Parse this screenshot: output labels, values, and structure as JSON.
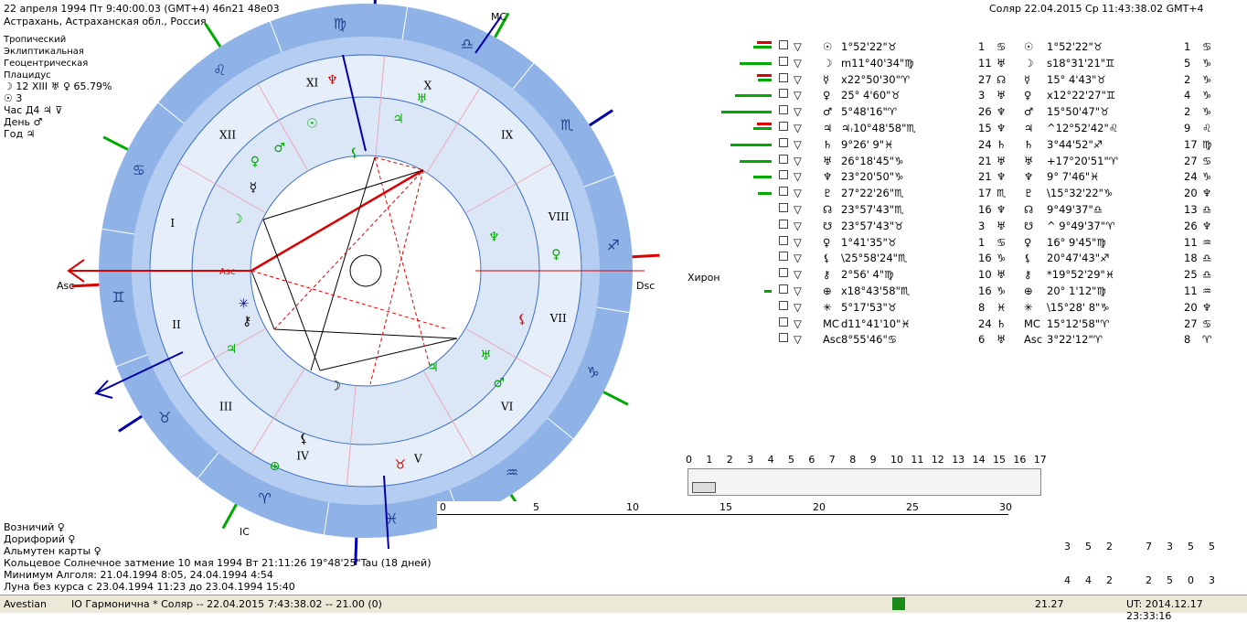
{
  "header": {
    "left_line1": "22 апреля 1994  Пт  9:40:00.03 (GMT+4) 46n21  48e03",
    "left_line2": "Астрахань, Астраханская обл., Россия",
    "right": "Соляр 22.04.2015  Ср 11:43:38.02 GMT+4"
  },
  "left_info": {
    "lines": [
      "Тропический",
      "Эклиптикальная",
      "Геоцентрическая",
      "Плацидус"
    ],
    "moon_line": "☽  12 XIII  ♅ ♀ 65.79%",
    "sun_line": "☉  3",
    "hour_line": "Час Д4 ♃ ⊽",
    "day_line": "День ♂",
    "year_line": "Год ♃"
  },
  "chart": {
    "houses_roman": [
      "I",
      "II",
      "III",
      "IV",
      "V",
      "VI",
      "VII",
      "VIII",
      "IX",
      "X",
      "XI",
      "XII"
    ],
    "signs": [
      "♈",
      "♉",
      "♊",
      "♋",
      "♌",
      "♍",
      "♎",
      "♏",
      "♐",
      "♑",
      "♒",
      "♓"
    ],
    "asc_label": "Asc",
    "dsc_label": "Dsc",
    "mc_label": "MC",
    "ic_label": "IC",
    "chiron_label": "Хирон"
  },
  "planet_table": {
    "rows": [
      {
        "g": "☉",
        "p1": "1°52'22\"♉",
        "n1": "1",
        "a1": "♋",
        "g2": "☉",
        "p2": "1°52'22\"♉",
        "n2": "1",
        "a2": "♋",
        "bar": 20,
        "red": true
      },
      {
        "g": "☽",
        "p1": "m11°40'34\"♍",
        "n1": "11",
        "a1": "♅",
        "g2": "☽",
        "p2": "s18°31'21\"♊",
        "n2": "5",
        "a2": "♑",
        "bar": 35,
        "red": false
      },
      {
        "g": "☿",
        "p1": "x22°50'30\"♈",
        "n1": "27",
        "a1": "☊",
        "g2": "☿",
        "p2": "15° 4'43\"♉",
        "n2": "2",
        "a2": "♑",
        "bar": 15,
        "red": true
      },
      {
        "g": "♀",
        "p1": "25° 4'60\"♉",
        "n1": "3",
        "a1": "♅",
        "g2": "♀",
        "p2": "x12°22'27\"♊",
        "n2": "4",
        "a2": "♑",
        "bar": 40,
        "red": false
      },
      {
        "g": "♂",
        "p1": "5°48'16\"♈",
        "n1": "26",
        "a1": "♆",
        "g2": "♂",
        "p2": "15°50'47\"♉",
        "n2": "2",
        "a2": "♑",
        "bar": 55,
        "red": false
      },
      {
        "g": "♃",
        "p1": "♃ᵣ10°48'58\"♏",
        "n1": "15",
        "a1": "♆",
        "g2": "♃",
        "p2": "^12°52'42\"♌",
        "n2": "9",
        "a2": "♌",
        "bar": 20,
        "red": true
      },
      {
        "g": "♄",
        "p1": "9°26' 9\"♓",
        "n1": "24",
        "a1": "♄",
        "g2": "♄",
        "p2": "3°44'52\"♐",
        "n2": "17",
        "a2": "♍",
        "bar": 45,
        "red": false
      },
      {
        "g": "♅",
        "p1": "26°18'45\"♑",
        "n1": "21",
        "a1": "♅",
        "g2": "♅",
        "p2": "+17°20'51\"♈",
        "n2": "27",
        "a2": "♋",
        "bar": 35,
        "red": false
      },
      {
        "g": "♆",
        "p1": "23°20'50\"♑",
        "n1": "21",
        "a1": "♆",
        "g2": "♆",
        "p2": "9° 7'46\"♓",
        "n2": "24",
        "a2": "♑",
        "bar": 20,
        "red": false
      },
      {
        "g": "♇",
        "p1": "27°22'26\"♏",
        "n1": "17",
        "a1": "♏",
        "g2": "♇",
        "p2": "\\15°32'22\"♑",
        "n2": "20",
        "a2": "♆",
        "bar": 15,
        "red": false
      },
      {
        "g": "☊",
        "p1": "23°57'43\"♏",
        "n1": "16",
        "a1": "♆",
        "g2": "☊",
        "p2": "9°49'37\"♎",
        "n2": "13",
        "a2": "♎",
        "bar": 0,
        "red": false
      },
      {
        "g": "☋",
        "p1": "23°57'43\"♉",
        "n1": "3",
        "a1": "♅",
        "g2": "☋",
        "p2": "^ 9°49'37\"♈",
        "n2": "26",
        "a2": "♆",
        "bar": 0,
        "red": false
      },
      {
        "g": "♀",
        "p1": "1°41'35\"♉",
        "n1": "1",
        "a1": "♋",
        "g2": "♀",
        "p2": "16° 9'45\"♍",
        "n2": "11",
        "a2": "♒",
        "bar": 0,
        "red": false
      },
      {
        "g": "⚸",
        "p1": "\\25°58'24\"♏",
        "n1": "16",
        "a1": "♑",
        "g2": "⚸",
        "p2": "20°47'43\"♐",
        "n2": "18",
        "a2": "♎",
        "bar": 0,
        "red": false
      },
      {
        "g": "⚷",
        "p1": "2°56' 4\"♍",
        "n1": "10",
        "a1": "♅",
        "g2": "⚷",
        "p2": "*19°52'29\"♓",
        "n2": "25",
        "a2": "♎",
        "bar": 0,
        "red": false
      },
      {
        "g": "⊕",
        "p1": "x18°43'58\"♏",
        "n1": "16",
        "a1": "♑",
        "g2": "⊕",
        "p2": "20° 1'12\"♍",
        "n2": "11",
        "a2": "♒",
        "bar": 8,
        "red": false
      },
      {
        "g": "✳",
        "p1": "5°17'53\"♉",
        "n1": "8",
        "a1": "♓",
        "g2": "✳",
        "p2": "\\15°28' 8\"♑",
        "n2": "20",
        "a2": "♆",
        "bar": 0,
        "red": false
      },
      {
        "g": "MC",
        "p1": "d11°41'10\"♓",
        "n1": "24",
        "a1": "♄",
        "g2": "MC",
        "p2": "15°12'58\"♈",
        "n2": "27",
        "a2": "♋",
        "bar": 0,
        "red": false
      },
      {
        "g": "Asc",
        "p1": "8°55'46\"♋",
        "n1": "6",
        "a1": "♅",
        "g2": "Asc",
        "p2": "3°22'12\"♈",
        "n2": "8",
        "a2": "♈",
        "bar": 0,
        "red": false
      }
    ]
  },
  "slider": {
    "ticks": [
      "0",
      "1",
      "2",
      "3",
      "4",
      "5",
      "6",
      "7",
      "8",
      "9",
      "10",
      "11",
      "12",
      "13",
      "14",
      "15",
      "16",
      "17"
    ],
    "value": 1
  },
  "timeline": {
    "ticks": [
      "0",
      "5",
      "10",
      "15",
      "20",
      "25",
      "30"
    ]
  },
  "lower_left": {
    "line1": "Возничий  ♀",
    "line2": "Дорифорий  ♀",
    "line3": "Альмутен карты  ♀",
    "line4": "Кольцевое Солнечное затмение 10 мая 1994 Вт 21:11:26 19°48'25\"Tau (18 дней)",
    "line5": "Минимум Алголя: 21.04.1994  8:05, 24.04.1994  4:54",
    "line6": "Луна без курса с 23.04.1994 11:23 до 23.04.1994 15:40"
  },
  "shape_grid": {
    "row1": [
      "3",
      "5",
      "2",
      "7",
      "3",
      "5",
      "5"
    ],
    "row2": [
      "4",
      "4",
      "2",
      "2",
      "5",
      "0",
      "3"
    ]
  },
  "status_bar": {
    "left": "Avestian",
    "mid": "IO Гармонична  * Соляр -- 22.04.2015  7:43:38.02 -- 21.00 (0)",
    "num": "21.27",
    "right": "UT: 2014.12.17 23:33:16"
  },
  "colors": {
    "ring": "#8fb3e6",
    "inner": "#e6eefa",
    "green": "#0a0",
    "red": "#d00",
    "blue": "#00a"
  }
}
